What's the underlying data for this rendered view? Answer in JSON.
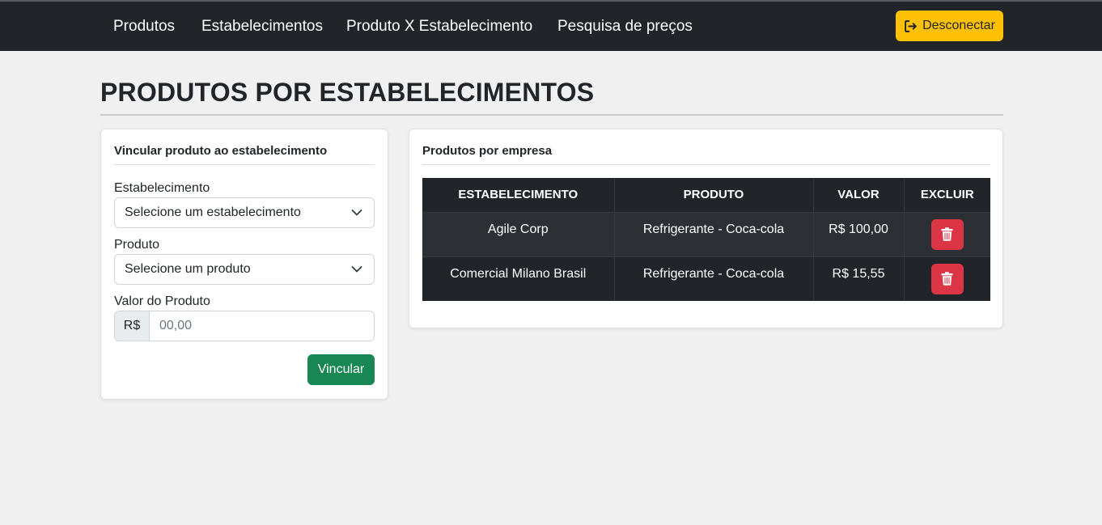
{
  "navbar": {
    "links": [
      "Produtos",
      "Estabelecimentos",
      "Produto X Estabelecimento",
      "Pesquisa de preços"
    ],
    "logout_label": "Desconectar",
    "logout_icon": "sign-out-icon"
  },
  "page": {
    "title": "PRODUTOS POR ESTABELECIMENTOS"
  },
  "form": {
    "title": "Vincular produto ao estabelecimento",
    "establishment_label": "Estabelecimento",
    "establishment_selected": "Selecione um estabelecimento",
    "product_label": "Produto",
    "product_selected": "Selecione um produto",
    "value_label": "Valor do Produto",
    "currency_prefix": "R$",
    "value_placeholder": "00,00",
    "submit_label": "Vincular"
  },
  "list": {
    "title": "Produtos por empresa",
    "columns": [
      "ESTABELECIMENTO",
      "PRODUTO",
      "VALOR",
      "EXCLUIR"
    ],
    "rows": [
      {
        "establishment": "Agile Corp",
        "product": "Refrigerante - Coca-cola",
        "value": "R$ 100,00"
      },
      {
        "establishment": "Comercial Milano Brasil",
        "product": "Refrigerante - Coca-cola",
        "value": "R$ 15,55"
      }
    ],
    "delete_icon": "trash-icon"
  },
  "colors": {
    "navbar_bg": "#212529",
    "warning": "#ffc107",
    "success": "#198754",
    "danger": "#dc3545",
    "page_bg": "#f0f0f0"
  }
}
